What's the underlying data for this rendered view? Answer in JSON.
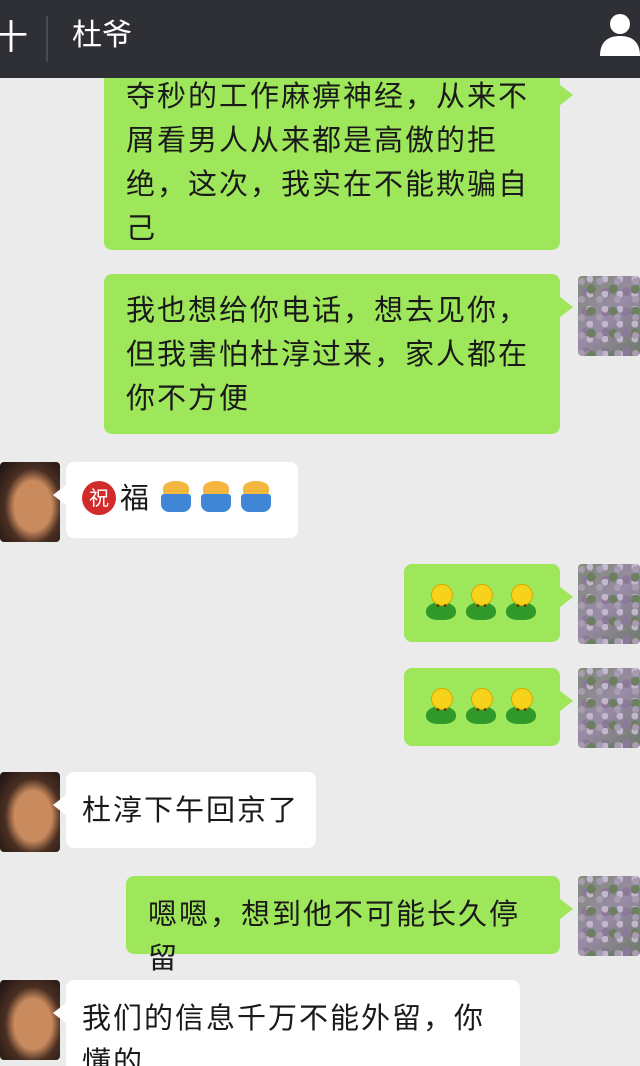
{
  "header": {
    "back_glyph": "十",
    "title": "杜爷",
    "profile_icon": "person-icon"
  },
  "messages": [
    {
      "side": "out",
      "text": "夺秒的工作麻痹神经，从来不屑看男人从来都是高傲的拒绝，这次，我实在不能欺骗自己"
    },
    {
      "side": "out",
      "text": "我也想给你电话，想去见你，但我害怕杜淳过来，家人都在你不方便"
    },
    {
      "side": "in",
      "badge": "祝",
      "text": "福",
      "emoji": [
        "cake-icon",
        "cake-icon",
        "cake-icon"
      ]
    },
    {
      "side": "out",
      "emoji": [
        "flower-icon",
        "flower-icon",
        "flower-icon"
      ]
    },
    {
      "side": "out",
      "emoji": [
        "flower-icon",
        "flower-icon",
        "flower-icon"
      ]
    },
    {
      "side": "in",
      "text": "杜淳下午回京了"
    },
    {
      "side": "out",
      "text": "嗯嗯，想到他不可能长久停留"
    },
    {
      "side": "in",
      "text": "我们的信息千万不能外留，你懂的"
    }
  ],
  "colors": {
    "header_bg": "#2f3035",
    "chat_bg": "#ebebeb",
    "outgoing_bubble": "#9fe75a",
    "incoming_bubble": "#ffffff"
  }
}
